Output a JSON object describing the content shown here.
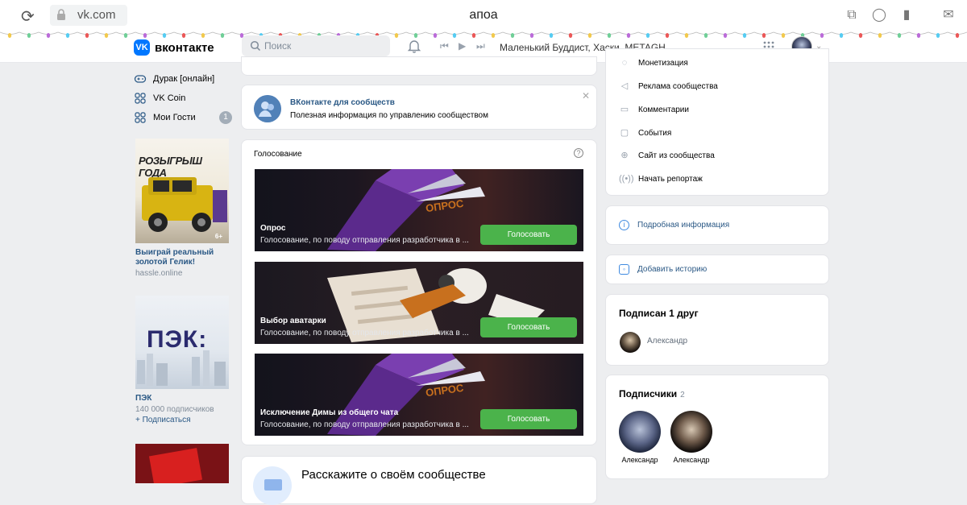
{
  "browser": {
    "url": "vk.com",
    "window_title": "апоа"
  },
  "header": {
    "logo_text": "вконтакте",
    "search_placeholder": "Поиск",
    "now_playing": "Маленький Буддист, Хаски, METAGH..."
  },
  "left_menu": {
    "items": [
      {
        "label": "Дурак [онлайн]",
        "icon": "gamepad-icon"
      },
      {
        "label": "VK Coin",
        "icon": "apps-icon"
      },
      {
        "label": "Мои Гости",
        "icon": "apps-icon",
        "badge": "1"
      }
    ]
  },
  "ads": [
    {
      "banner_text": "РОЗЫГРЫШ ГОДА",
      "age": "6+",
      "title": "Выиграй реальный золотой Гелик!",
      "subtitle": "hassle.online"
    },
    {
      "banner_text": "ПЭК:",
      "title": "ПЭК",
      "subtitle": "140 000 подписчиков",
      "action": "+ Подписаться"
    }
  ],
  "community_tip": {
    "title": "ВКонтакте для сообществ",
    "desc": "Полезная информация по управлению сообществом"
  },
  "voting": {
    "header": "Голосование",
    "polls": [
      {
        "name": "Опрос",
        "desc": "Голосование, по поводу отправления разработчика в ...",
        "button": "Голосовать",
        "art_text": "ОПРОС"
      },
      {
        "name": "Выбор аватарки",
        "desc": "Голосование, по поводу отправления разработчика в ...",
        "button": "Голосовать"
      },
      {
        "name": "Исключение Димы из общего чата",
        "desc": "Голосование, по поводу отправления разработчика в ...",
        "button": "Голосовать",
        "art_text": "ОПРОС"
      }
    ]
  },
  "tell_card": {
    "title": "Расскажите о своём сообществе"
  },
  "right_menu": {
    "items": [
      {
        "label": "Монетизация",
        "icon": "money-icon"
      },
      {
        "label": "Реклама сообщества",
        "icon": "megaphone-icon"
      },
      {
        "label": "Комментарии",
        "icon": "comment-icon"
      },
      {
        "label": "События",
        "icon": "calendar-icon"
      },
      {
        "label": "Сайт из сообщества",
        "icon": "globe-icon"
      },
      {
        "label": "Начать репортаж",
        "icon": "broadcast-icon"
      }
    ]
  },
  "detail_link": "Подробная информация",
  "story_link": "Добавить историю",
  "subscribed": {
    "title": "Подписан 1 друг",
    "friend": "Александр"
  },
  "followers": {
    "title": "Подписчики",
    "count": "2",
    "names": [
      "Александр",
      "Александр"
    ]
  },
  "colors": {
    "accent": "#0077ff",
    "link": "#2a5885",
    "vote_button": "#4bb34b",
    "background": "#edeef0"
  }
}
